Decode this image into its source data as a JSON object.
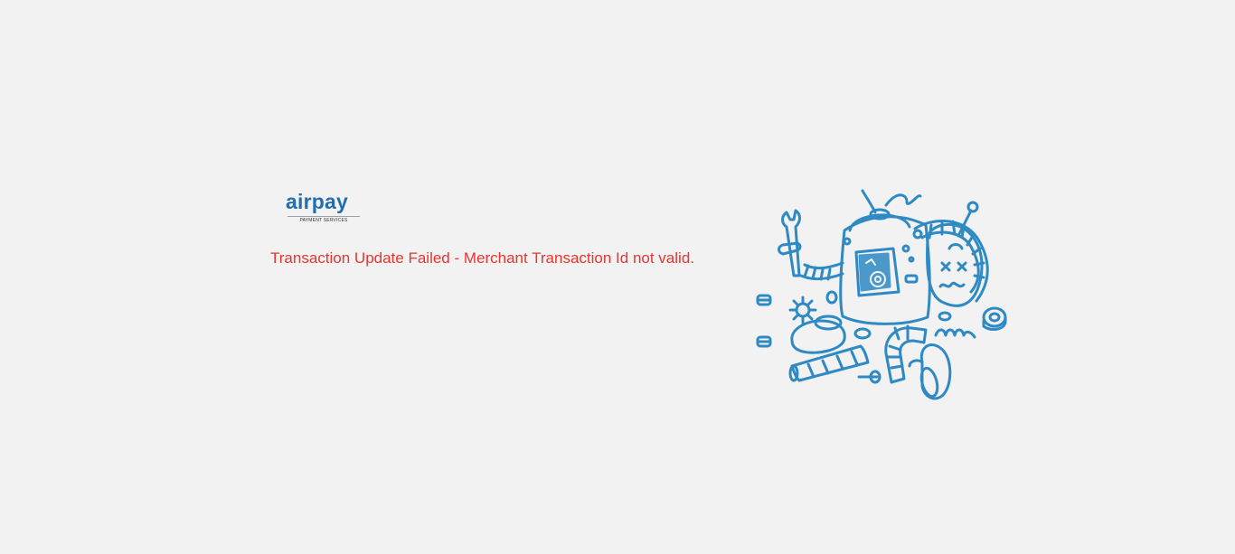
{
  "logo": {
    "name": "airpay",
    "tagline": "PAYMENT SERVICES"
  },
  "message": {
    "text": "Transaction Update Failed - Merchant Transaction Id not valid.",
    "color": "#e8352f"
  },
  "illustration": {
    "icon": "broken-robot-icon",
    "color": "#2f8ac4"
  }
}
